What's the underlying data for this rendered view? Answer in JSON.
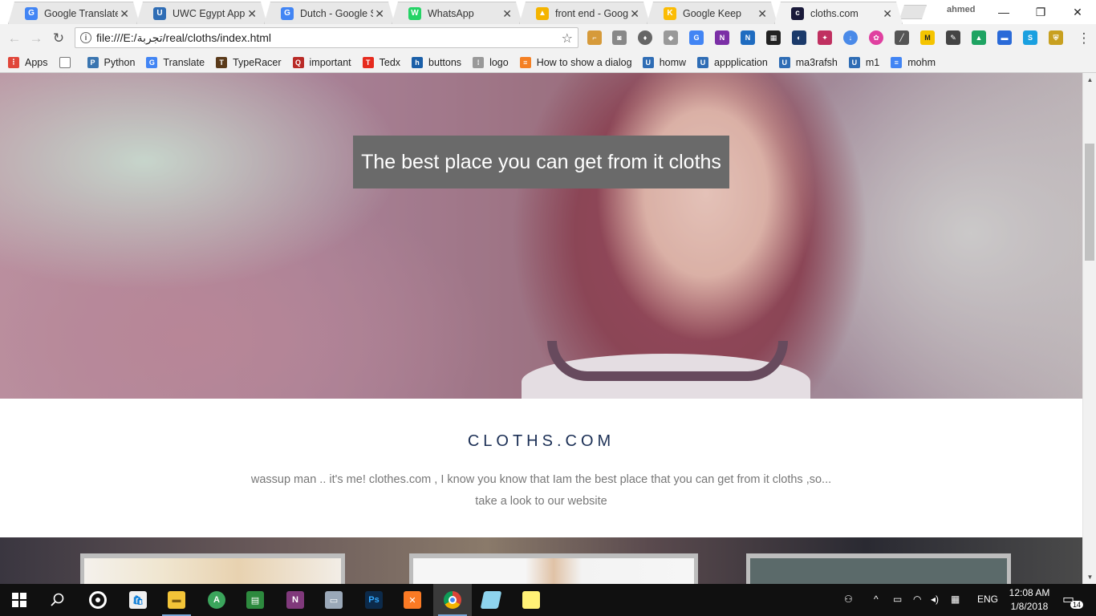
{
  "browser": {
    "tabs": [
      {
        "title": "Google Translate",
        "icon": "google-translate-icon",
        "color": "#4285f4",
        "glyph": "G"
      },
      {
        "title": "UWC Egypt Applic",
        "icon": "uwc-icon",
        "color": "#2f6db5",
        "glyph": "U"
      },
      {
        "title": "Dutch - Google Se",
        "icon": "google-icon",
        "color": "#4285f4",
        "glyph": "G"
      },
      {
        "title": "WhatsApp",
        "icon": "whatsapp-icon",
        "color": "#25d366",
        "glyph": "W"
      },
      {
        "title": "front end - Google",
        "icon": "google-drive-icon",
        "color": "#f4b400",
        "glyph": "▲"
      },
      {
        "title": "Google Keep",
        "icon": "google-keep-icon",
        "color": "#fbbc04",
        "glyph": "K"
      },
      {
        "title": "cloths.com",
        "icon": "site-icon",
        "color": "#1a1a3a",
        "glyph": "c",
        "active": true
      }
    ],
    "profile_name": "ahmed",
    "url": "file:///E:/تجربة/real/cloths/index.html",
    "bookmarks": [
      {
        "label": "Apps",
        "icon": "apps-grid-icon",
        "color": "#e0463a",
        "glyph": "⋮"
      },
      {
        "label": "",
        "icon": "page-icon",
        "color": "#ffffff",
        "glyph": ""
      },
      {
        "label": "Python",
        "icon": "python-icon",
        "color": "#3a75b0",
        "glyph": "P"
      },
      {
        "label": "Translate",
        "icon": "google-translate-icon",
        "color": "#4285f4",
        "glyph": "G"
      },
      {
        "label": "TypeRacer",
        "icon": "typeracer-icon",
        "color": "#5a3a1a",
        "glyph": "T"
      },
      {
        "label": "important",
        "icon": "quora-icon",
        "color": "#b92b27",
        "glyph": "Q"
      },
      {
        "label": "Tedx",
        "icon": "tedx-icon",
        "color": "#e62b1e",
        "glyph": "T"
      },
      {
        "label": "buttons",
        "icon": "hm-icon",
        "color": "#1a5fa8",
        "glyph": "h"
      },
      {
        "label": "logo",
        "icon": "grid-dots-icon",
        "color": "#999999",
        "glyph": "⁞"
      },
      {
        "label": "How to show a dialog",
        "icon": "stackoverflow-icon",
        "color": "#f48024",
        "glyph": "≡"
      },
      {
        "label": "homw",
        "icon": "uwc-icon",
        "color": "#2f6db5",
        "glyph": "U"
      },
      {
        "label": "appplication",
        "icon": "uwc-icon",
        "color": "#2f6db5",
        "glyph": "U"
      },
      {
        "label": "ma3rafsh",
        "icon": "uwc-icon",
        "color": "#2f6db5",
        "glyph": "U"
      },
      {
        "label": "m1",
        "icon": "uwc-icon",
        "color": "#2f6db5",
        "glyph": "U"
      },
      {
        "label": "mohm",
        "icon": "google-docs-icon",
        "color": "#4285f4",
        "glyph": "≡"
      }
    ]
  },
  "page": {
    "hero_caption": "The best place you can get from it cloths",
    "brand": "CLOTHS.COM",
    "blurb_line1": "wassup man .. it's me! clothes.com , I know you know that Iam the best place that you can get from it cloths ,so...",
    "blurb_line2": "take a look to our website"
  },
  "taskbar": {
    "language": "ENG",
    "time": "12:08 AM",
    "date": "1/8/2018",
    "notification_count": "14"
  }
}
